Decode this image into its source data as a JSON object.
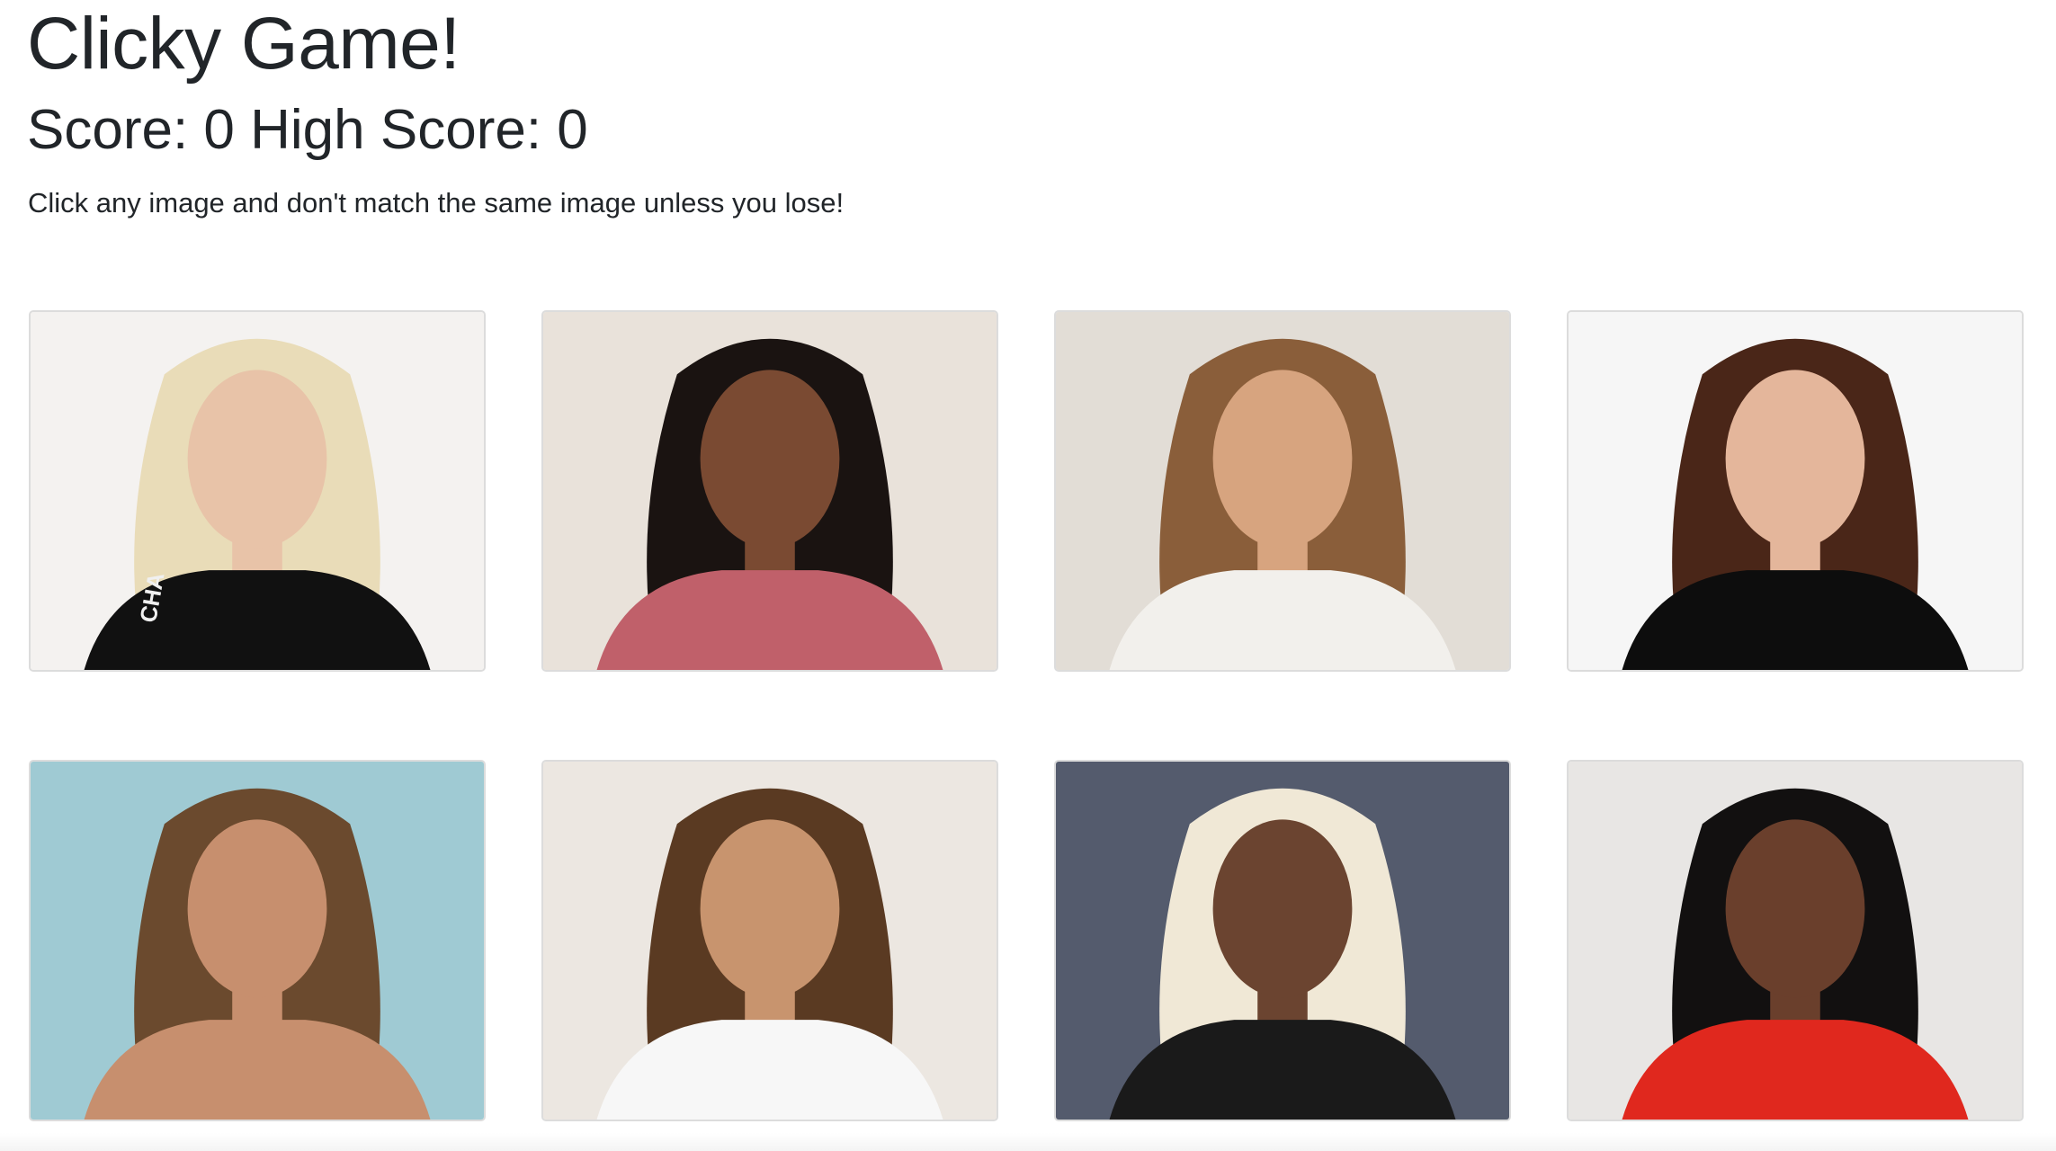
{
  "header": {
    "title": "Clicky Game!",
    "score_label": "Score: ",
    "score": "0",
    "high_score_label": " High Score: ",
    "high_score": "0",
    "instructions": "Click any image and don't match the same image unless you lose!"
  },
  "cards": [
    {
      "name": "card-1",
      "hair": "#e9dcb8",
      "skin": "#e8c3a8",
      "top": "#111111",
      "bg": "#f4f2f0",
      "printed_text": "CHA"
    },
    {
      "name": "card-2",
      "hair": "#1a1311",
      "skin": "#7a4a32",
      "top": "#c0606a",
      "bg": "#e9e2da"
    },
    {
      "name": "card-3",
      "hair": "#8a5e3a",
      "skin": "#d7a47f",
      "top": "#f2f0ec",
      "bg": "#e2ddd6"
    },
    {
      "name": "card-4",
      "hair": "#4a2618",
      "skin": "#e4b69b",
      "top": "#0d0d0d",
      "bg": "#f6f6f6"
    },
    {
      "name": "card-5",
      "hair": "#6b4a2e",
      "skin": "#c78f6e",
      "top": "#c78f6e",
      "bg": "#9fcad3"
    },
    {
      "name": "card-6",
      "hair": "#5a3a22",
      "skin": "#c8946e",
      "top": "#f7f7f7",
      "bg": "#ece7e1"
    },
    {
      "name": "card-7",
      "hair": "#f0e8d6",
      "skin": "#6b4430",
      "top": "#1a1a1a",
      "bg": "#545b6d"
    },
    {
      "name": "card-8",
      "hair": "#121010",
      "skin": "#6a3f2c",
      "top": "#e0281e",
      "bg": "#e8e6e4"
    }
  ]
}
